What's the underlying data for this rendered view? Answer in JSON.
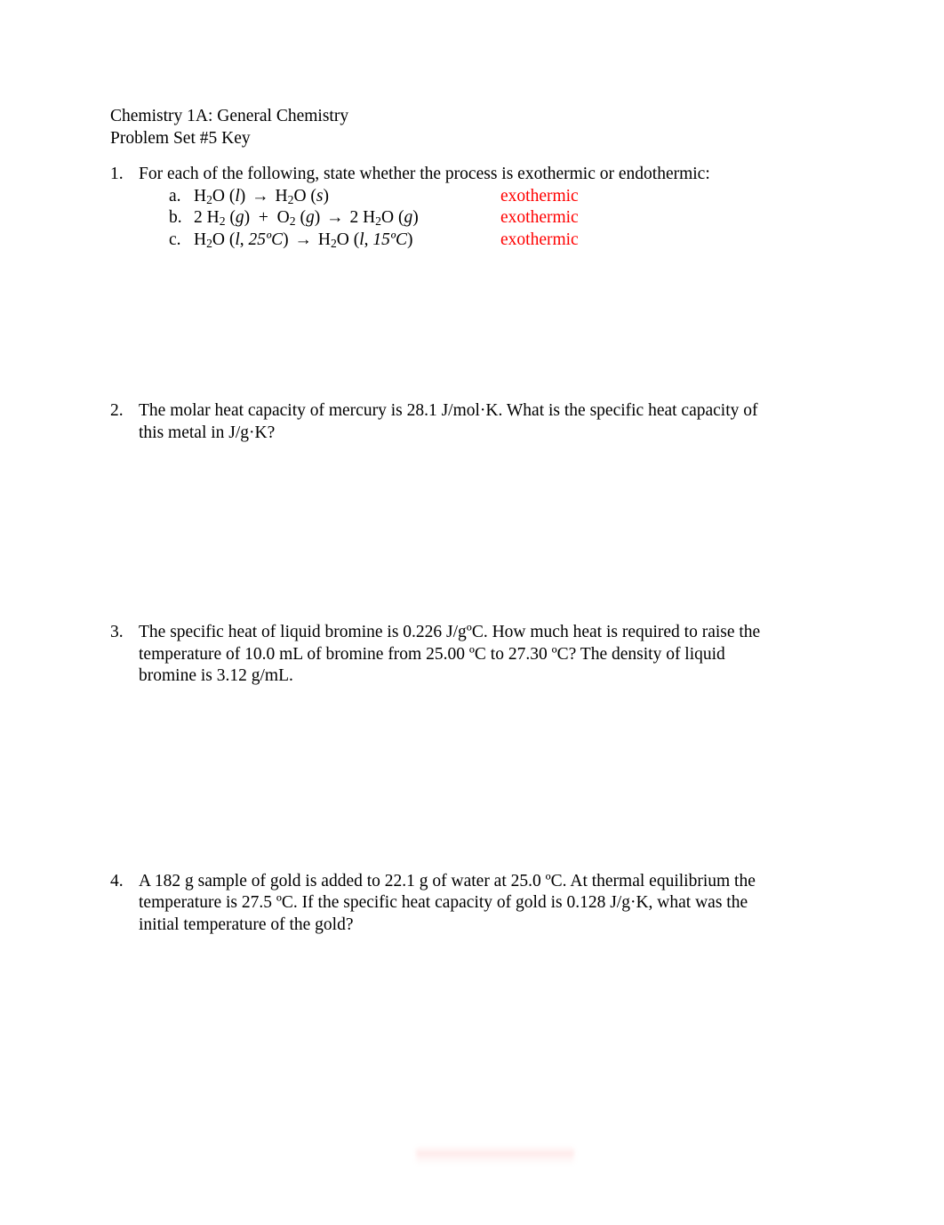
{
  "document": {
    "course_line": "Chemistry 1A:  General Chemistry",
    "assignment_line": "Problem Set #5 Key",
    "answer_color": "#ff0000",
    "text_color": "#000000",
    "background_color": "#ffffff"
  },
  "questions": [
    {
      "number": "1.",
      "prompt": "For each of the following, state whether the process is exothermic or endothermic:",
      "subitems": [
        {
          "letter": "a.",
          "equation_plain": "H2O (l)  →  H2O (s)",
          "left_formula": "H",
          "left_sub": "2",
          "left_rest": "O (",
          "left_state": "l",
          "right_formula": "H",
          "right_sub": "2",
          "right_rest": "O (",
          "right_state": "s",
          "answer": "exothermic"
        },
        {
          "letter": "b.",
          "equation_plain": "2 H2 (g)  +  O2 (g)  →  2 H2O (g)",
          "answer": "exothermic"
        },
        {
          "letter": "c.",
          "equation_plain": "H2O (l, 25ºC)  →  H2O (l, 15ºC)",
          "temp_left": "25ºC",
          "temp_right": "15ºC",
          "answer": "exothermic"
        }
      ]
    },
    {
      "number": "2.",
      "prompt_line_1": "The molar heat capacity of mercury is 28.1 J/mol·K.  What is the specific heat capacity of",
      "prompt_line_2": "this metal in J/g·K?",
      "values": {
        "molar_heat_capacity": "28.1 J/mol·K",
        "substance": "mercury",
        "requested_units": "J/g·K"
      }
    },
    {
      "number": "3.",
      "prompt_line_1": "The specific heat of liquid bromine is 0.226 J/gºC.  How much heat is required to raise the",
      "prompt_line_2": "temperature of 10.0 mL of bromine from 25.00 ºC to 27.30 ºC?  The density of liquid",
      "prompt_line_3": "bromine is 3.12 g/mL.",
      "values": {
        "specific_heat": "0.226 J/gºC",
        "volume": "10.0 mL",
        "t_initial": "25.00 ºC",
        "t_final": "27.30 ºC",
        "density": "3.12 g/mL"
      }
    },
    {
      "number": "4.",
      "prompt_line_1": "A 182 g sample of gold is added to 22.1 g of water at 25.0 ºC.  At thermal equilibrium the",
      "prompt_line_2": "temperature is 27.5 ºC.  If the specific heat capacity of gold is 0.128 J/g·K, what was the",
      "prompt_line_3": "initial temperature of the gold?",
      "values": {
        "gold_mass": "182 g",
        "water_mass": "22.1 g",
        "water_temp": "25.0 ºC",
        "equilibrium_temp": "27.5 ºC",
        "gold_specific_heat": "0.128 J/g·K"
      }
    }
  ]
}
